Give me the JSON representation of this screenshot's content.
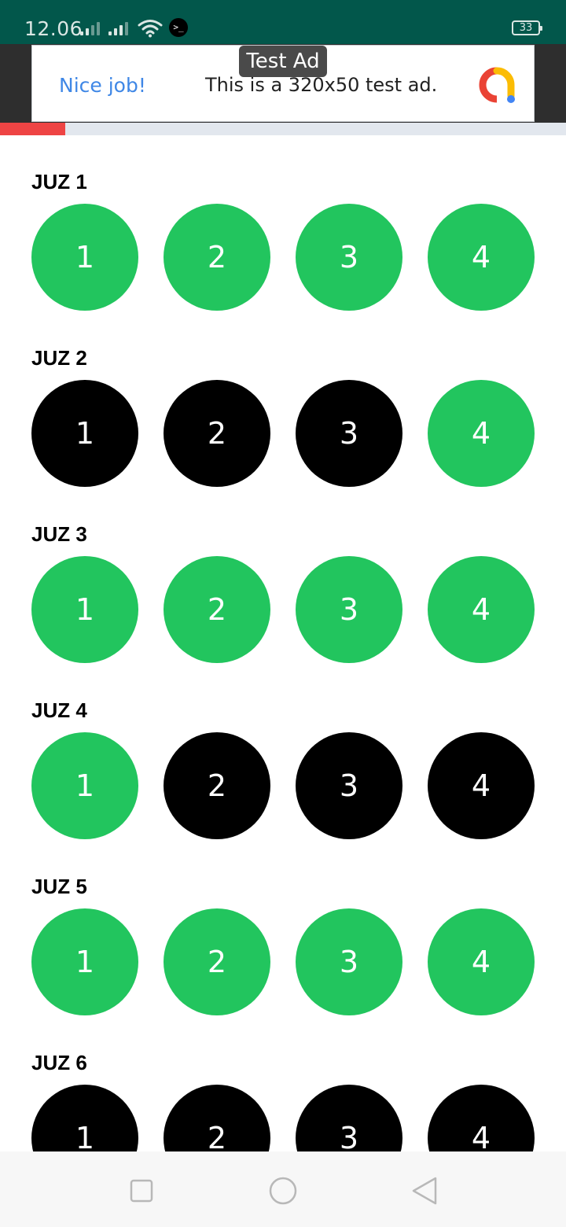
{
  "status_bar": {
    "time": "12.06",
    "battery": "33",
    "icons": [
      "signal-icon",
      "signal-icon",
      "wifi-icon",
      "terminal-icon",
      "battery-icon"
    ]
  },
  "ad": {
    "badge": "Test Ad",
    "headline": "Nice job!",
    "body": "This is a 320x50 test ad.",
    "icon": "admob-logo-icon",
    "colors": {
      "headline": "#3f87e6"
    }
  },
  "progress": {
    "fraction": 0.115,
    "color": "#ee4444",
    "track_color": "#e2e7ee"
  },
  "colors": {
    "done": "#22c55e",
    "todo": "#000000"
  },
  "juz": [
    {
      "title": "JUZ 1",
      "parts": [
        {
          "label": "1",
          "done": true
        },
        {
          "label": "2",
          "done": true
        },
        {
          "label": "3",
          "done": true
        },
        {
          "label": "4",
          "done": true
        }
      ]
    },
    {
      "title": "JUZ 2",
      "parts": [
        {
          "label": "1",
          "done": false
        },
        {
          "label": "2",
          "done": false
        },
        {
          "label": "3",
          "done": false
        },
        {
          "label": "4",
          "done": true
        }
      ]
    },
    {
      "title": "JUZ 3",
      "parts": [
        {
          "label": "1",
          "done": true
        },
        {
          "label": "2",
          "done": true
        },
        {
          "label": "3",
          "done": true
        },
        {
          "label": "4",
          "done": true
        }
      ]
    },
    {
      "title": "JUZ 4",
      "parts": [
        {
          "label": "1",
          "done": true
        },
        {
          "label": "2",
          "done": false
        },
        {
          "label": "3",
          "done": false
        },
        {
          "label": "4",
          "done": false
        }
      ]
    },
    {
      "title": "JUZ 5",
      "parts": [
        {
          "label": "1",
          "done": true
        },
        {
          "label": "2",
          "done": true
        },
        {
          "label": "3",
          "done": true
        },
        {
          "label": "4",
          "done": true
        }
      ]
    },
    {
      "title": "JUZ 6",
      "parts": [
        {
          "label": "1",
          "done": false
        },
        {
          "label": "2",
          "done": false
        },
        {
          "label": "3",
          "done": false
        },
        {
          "label": "4",
          "done": false
        }
      ]
    }
  ],
  "nav_bar": {
    "buttons": [
      "recents-icon",
      "home-icon",
      "back-icon"
    ]
  }
}
